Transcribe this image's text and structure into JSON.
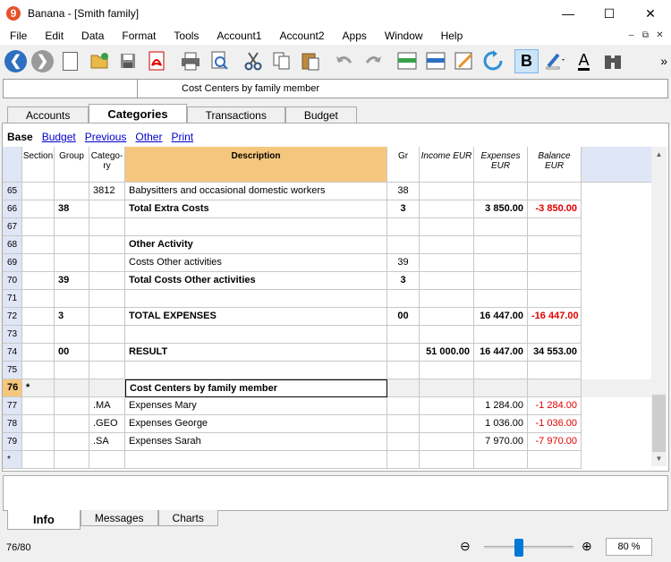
{
  "window": {
    "logo": "9",
    "title": "Banana - [Smith family]",
    "minimize": "—",
    "maximize": "☐",
    "close": "✕"
  },
  "menu": [
    "File",
    "Edit",
    "Data",
    "Format",
    "Tools",
    "Account1",
    "Account2",
    "Apps",
    "Window",
    "Help"
  ],
  "mdi": [
    "–",
    "⧉",
    "✕"
  ],
  "toolbar": {
    "bold_label": "B",
    "text_color_label": "A",
    "more": "»"
  },
  "cellbar": {
    "value": "Cost Centers by family member"
  },
  "tabs": [
    "Accounts",
    "Categories",
    "Transactions",
    "Budget"
  ],
  "active_tab": "Categories",
  "views": {
    "current": "Base",
    "links": [
      "Budget",
      "Previous",
      "Other",
      "Print"
    ]
  },
  "columns": {
    "section": "Section",
    "group": "Group",
    "category": "Catego-\nry",
    "description": "Description",
    "gr": "Gr",
    "income": "Income EUR",
    "expenses": "Expenses\nEUR",
    "balance": "Balance EUR"
  },
  "rows": [
    {
      "no": "65",
      "section": "",
      "group": "",
      "category": "3812",
      "description": "Babysitters and occasional domestic workers",
      "gr": "38",
      "income": "",
      "expenses": "",
      "balance": "",
      "bold": false
    },
    {
      "no": "66",
      "section": "",
      "group": "38",
      "category": "",
      "description": "Total Extra Costs",
      "gr": "3",
      "income": "",
      "expenses": "3 850.00",
      "balance": "-3 850.00",
      "bold": true
    },
    {
      "no": "67",
      "section": "",
      "group": "",
      "category": "",
      "description": "",
      "gr": "",
      "income": "",
      "expenses": "",
      "balance": "",
      "bold": false
    },
    {
      "no": "68",
      "section": "",
      "group": "",
      "category": "",
      "description": "Other Activity",
      "gr": "",
      "income": "",
      "expenses": "",
      "balance": "",
      "bold": true
    },
    {
      "no": "69",
      "section": "",
      "group": "",
      "category": "",
      "description": "Costs Other activities",
      "gr": "39",
      "income": "",
      "expenses": "",
      "balance": "",
      "bold": false
    },
    {
      "no": "70",
      "section": "",
      "group": "39",
      "category": "",
      "description": "Total Costs Other activities",
      "gr": "3",
      "income": "",
      "expenses": "",
      "balance": "",
      "bold": true
    },
    {
      "no": "71",
      "section": "",
      "group": "",
      "category": "",
      "description": "",
      "gr": "",
      "income": "",
      "expenses": "",
      "balance": "",
      "bold": false
    },
    {
      "no": "72",
      "section": "",
      "group": "3",
      "category": "",
      "description": "TOTAL EXPENSES",
      "gr": "00",
      "income": "",
      "expenses": "16 447.00",
      "balance": "-16 447.00",
      "bold": true
    },
    {
      "no": "73",
      "section": "",
      "group": "",
      "category": "",
      "description": "",
      "gr": "",
      "income": "",
      "expenses": "",
      "balance": "",
      "bold": false
    },
    {
      "no": "74",
      "section": "",
      "group": "00",
      "category": "",
      "description": "RESULT",
      "gr": "",
      "income": "51 000.00",
      "expenses": "16 447.00",
      "balance": "34 553.00",
      "bold": true
    },
    {
      "no": "75",
      "section": "",
      "group": "",
      "category": "",
      "description": "",
      "gr": "",
      "income": "",
      "expenses": "",
      "balance": "",
      "bold": false
    },
    {
      "no": "76",
      "section": "*",
      "group": "",
      "category": "",
      "description": "Cost Centers by family member",
      "gr": "",
      "income": "",
      "expenses": "",
      "balance": "",
      "bold": true,
      "current": true
    },
    {
      "no": "77",
      "section": "",
      "group": "",
      "category": ".MA",
      "description": "Expenses Mary",
      "gr": "",
      "income": "",
      "expenses": "1 284.00",
      "balance": "-1 284.00",
      "bold": false
    },
    {
      "no": "78",
      "section": "",
      "group": "",
      "category": ".GEO",
      "description": "Expenses George",
      "gr": "",
      "income": "",
      "expenses": "1 036.00",
      "balance": "-1 036.00",
      "bold": false
    },
    {
      "no": "79",
      "section": "",
      "group": "",
      "category": ".SA",
      "description": "Expenses Sarah",
      "gr": "",
      "income": "",
      "expenses": "7 970.00",
      "balance": "-7 970.00",
      "bold": false
    },
    {
      "no": "*",
      "section": "",
      "group": "",
      "category": "",
      "description": "",
      "gr": "",
      "income": "",
      "expenses": "",
      "balance": "",
      "bold": false
    }
  ],
  "bottom_tabs": [
    "Info",
    "Messages",
    "Charts"
  ],
  "status": {
    "position": "76/80",
    "zoom": "80 %",
    "zoom_minus": "⊖",
    "zoom_plus": "⊕"
  }
}
